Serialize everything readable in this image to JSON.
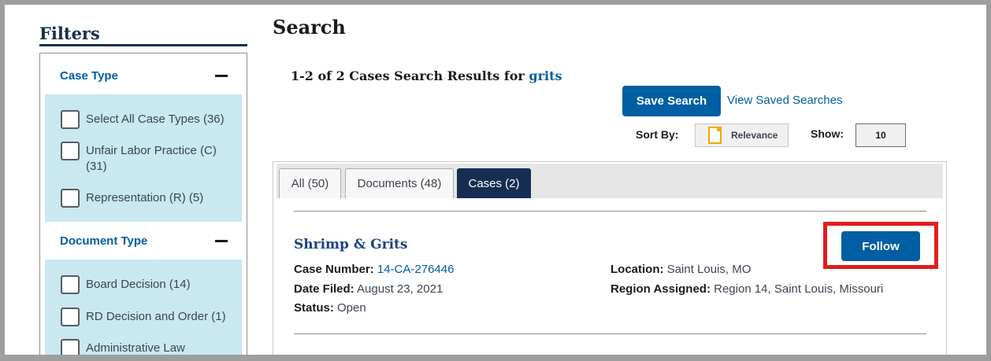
{
  "sidebar": {
    "title": "Filters",
    "sections": [
      {
        "label": "Case Type",
        "items": [
          {
            "label": "Select All Case Types (36)"
          },
          {
            "label": "Unfair Labor Practice (C) (31)"
          },
          {
            "label": "Representation (R) (5)"
          }
        ]
      },
      {
        "label": "Document Type",
        "items": [
          {
            "label": "Board Decision (14)"
          },
          {
            "label": "RD Decision and Order (1)"
          },
          {
            "label": "Administrative Law"
          }
        ]
      }
    ]
  },
  "main": {
    "title": "Search",
    "results_prefix": "1-2 of 2 Cases Search Results for ",
    "search_term": "grits",
    "save_search_label": "Save Search",
    "view_saved_label": "View Saved Searches",
    "sort_by_label": "Sort By:",
    "sort_value": "Relevance",
    "show_label": "Show:",
    "show_value": "10",
    "tabs": [
      {
        "label": "All (50)"
      },
      {
        "label": "Documents (48)"
      },
      {
        "label": "Cases (2)",
        "active": true
      }
    ],
    "result": {
      "title": "Shrimp & Grits",
      "follow_label": "Follow",
      "case_number_label": "Case Number:",
      "case_number": "14-CA-276446",
      "date_filed_label": "Date Filed:",
      "date_filed": "August 23, 2021",
      "status_label": "Status:",
      "status": "Open",
      "location_label": "Location:",
      "location": "Saint Louis, MO",
      "region_label": "Region Assigned:",
      "region": "Region 14, Saint Louis, Missouri"
    }
  },
  "colors": {
    "primary": "#005ea2",
    "navy": "#162e51",
    "filter_bg": "#c9e8ef",
    "highlight": "#e31c1c"
  }
}
